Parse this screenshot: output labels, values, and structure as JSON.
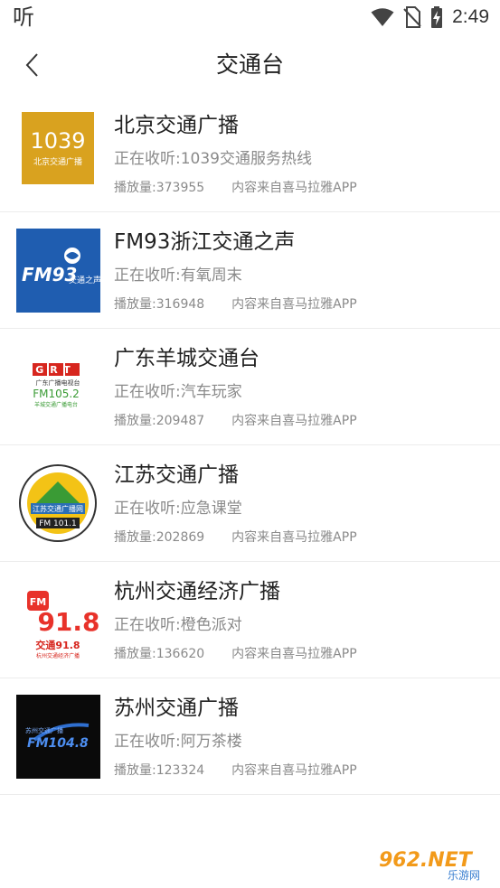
{
  "status_bar": {
    "app_label": "听",
    "time": "2:49",
    "icons": [
      "wifi-icon",
      "no-sim-icon",
      "battery-charging-icon"
    ]
  },
  "header": {
    "title": "交通台",
    "back_icon": "chevron-left-icon"
  },
  "stations": [
    {
      "name": "北京交通广播",
      "now_playing": "正在收听:1039交通服务热线",
      "plays": "播放量:373955",
      "source": "内容来自喜马拉雅APP",
      "logo": {
        "text_main": "1039",
        "text_sub": "北京交通广播",
        "bg": "#d9a21f"
      }
    },
    {
      "name": "FM93浙江交通之声",
      "now_playing": "正在收听:有氧周末",
      "plays": "播放量:316948",
      "source": "内容来自喜马拉雅APP",
      "logo": {
        "text_main": "FM93",
        "text_sub": "交通之声",
        "bg": "#1f5db0"
      }
    },
    {
      "name": "广东羊城交通台",
      "now_playing": "正在收听:汽车玩家",
      "plays": "播放量:209487",
      "source": "内容来自喜马拉雅APP",
      "logo": {
        "text_main": "GRT",
        "text_sub": "广东广播电视台",
        "text_freq": "FM105.2",
        "text_foot": "羊城交通广播电台",
        "bg": "#ffffff"
      }
    },
    {
      "name": "江苏交通广播",
      "now_playing": "正在收听:应急课堂",
      "plays": "播放量:202869",
      "source": "内容来自喜马拉雅APP",
      "logo": {
        "text_main": "江苏交通广播网",
        "text_freq": "FM 101.1",
        "bg": "#ffffff"
      }
    },
    {
      "name": "杭州交通经济广播",
      "now_playing": "正在收听:橙色派对",
      "plays": "播放量:136620",
      "source": "内容来自喜马拉雅APP",
      "logo": {
        "text_main": "91.8",
        "text_fm": "FM",
        "text_sub": "交通91.8",
        "text_foot": "杭州交通经济广播",
        "bg": "#ffffff"
      }
    },
    {
      "name": "苏州交通广播",
      "now_playing": "正在收听:阿万茶楼",
      "plays": "播放量:123324",
      "source": "内容来自喜马拉雅APP",
      "logo": {
        "text_main": "FM104.8",
        "text_sub": "苏州交通广播",
        "bg": "#0a0a0a"
      }
    }
  ],
  "watermark": {
    "text": "962.NET",
    "sub": "乐游网"
  }
}
